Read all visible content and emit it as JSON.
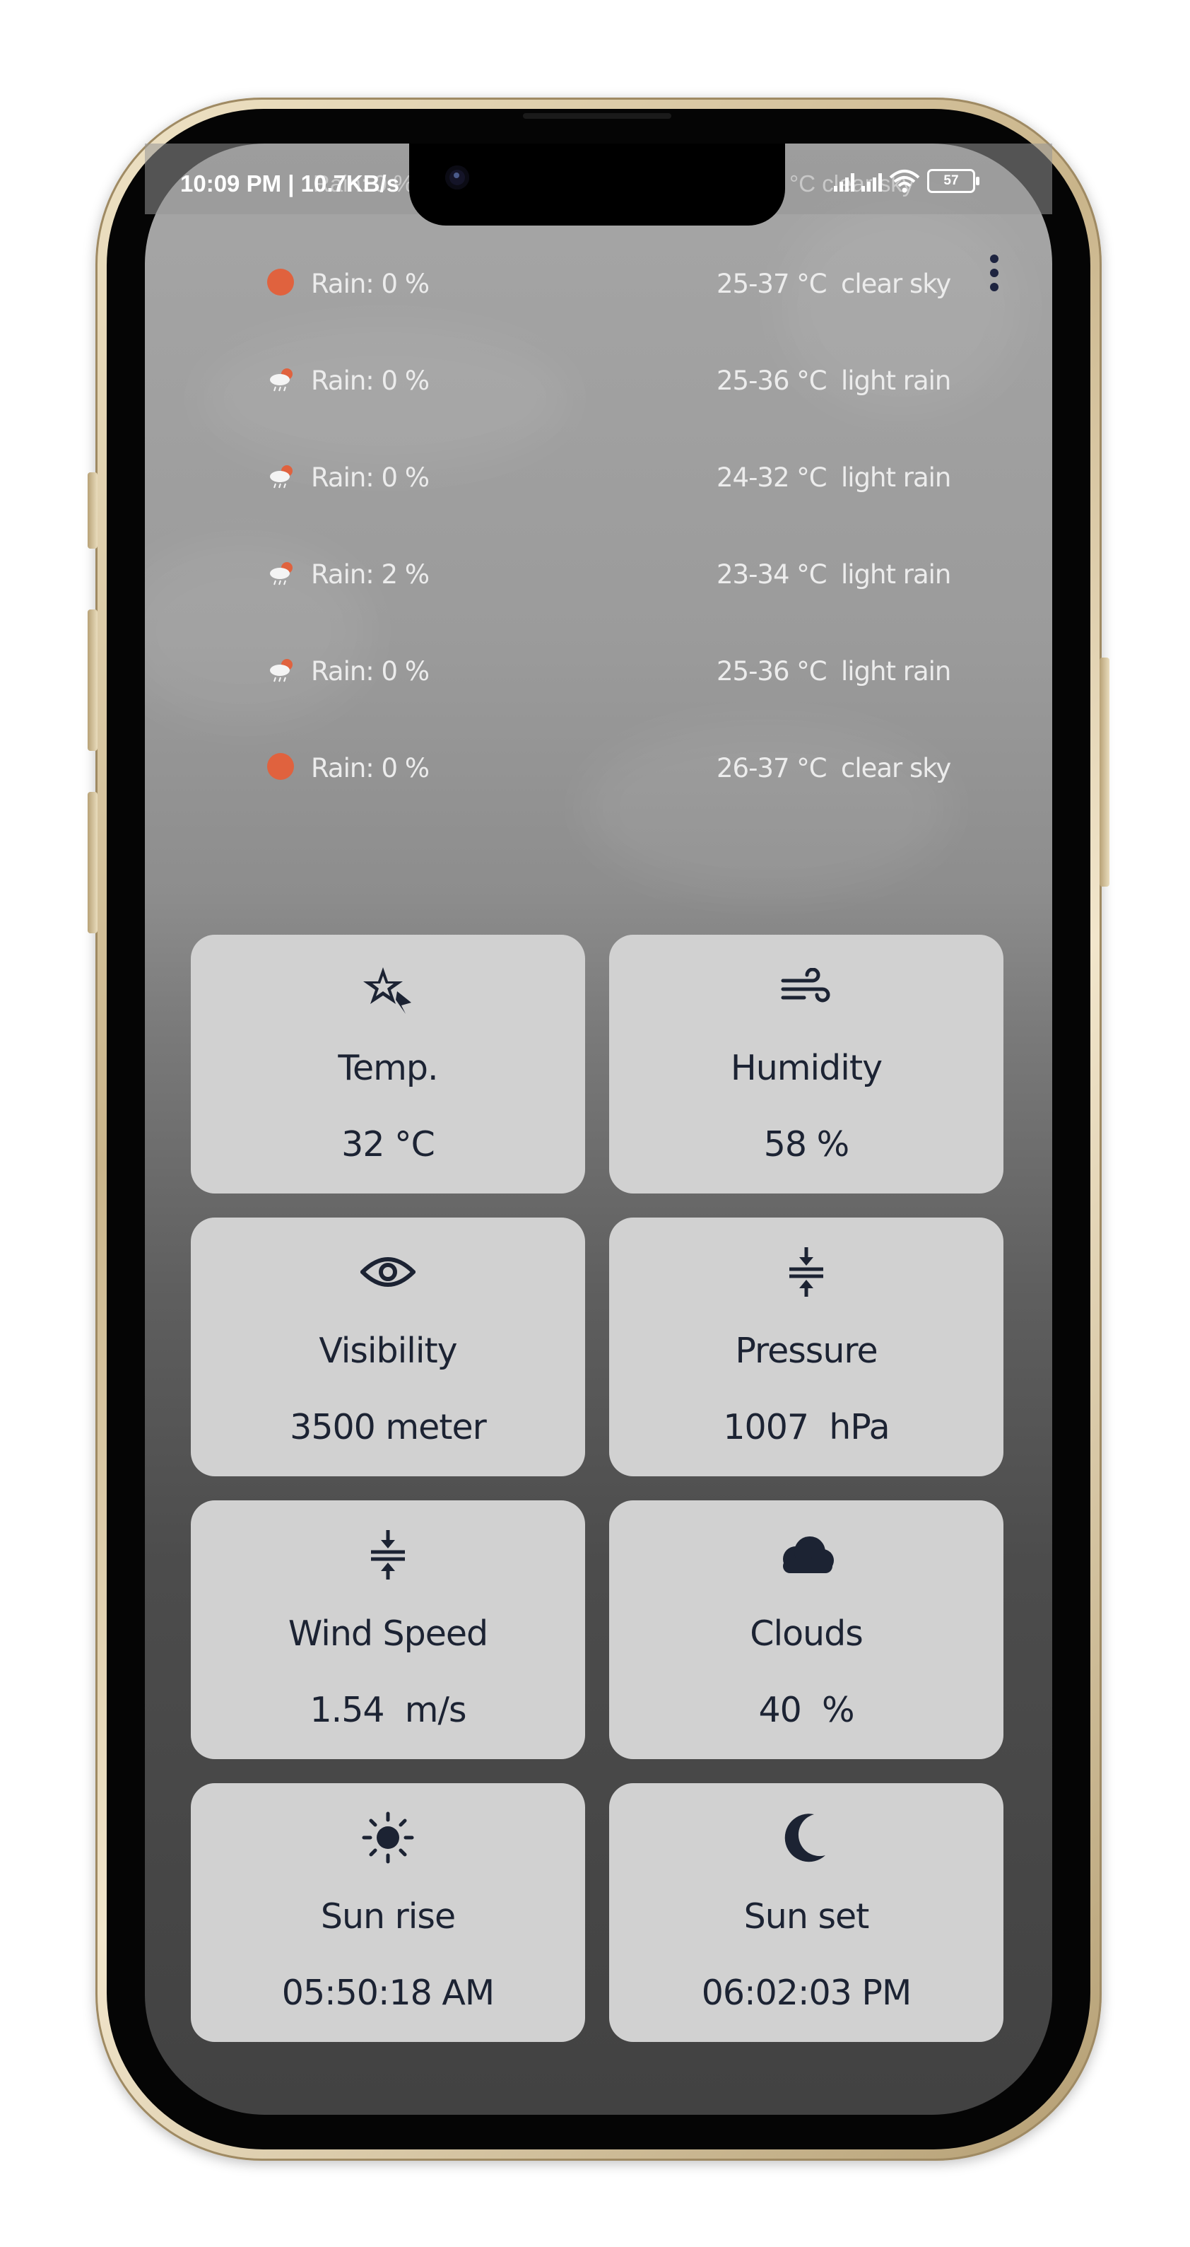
{
  "status_bar": {
    "time": "10:09 PM | 10.7KB/s",
    "ghost_left": "Rain: 0 %",
    "ghost_right": "°C  clear sky",
    "battery": "57",
    "icons": [
      "signal-icon",
      "signal-icon",
      "wifi-icon",
      "battery-icon"
    ]
  },
  "forecast": {
    "rows": [
      {
        "icon": "sun-dot-icon",
        "rain": "Rain: 0 %",
        "temp": "25-37 °C",
        "desc": "clear sky"
      },
      {
        "icon": "rain-cloud-icon",
        "rain": "Rain: 0 %",
        "temp": "25-36 °C",
        "desc": "light rain"
      },
      {
        "icon": "rain-cloud-icon",
        "rain": "Rain: 0 %",
        "temp": "24-32 °C",
        "desc": "light rain"
      },
      {
        "icon": "rain-cloud-icon",
        "rain": "Rain: 2 %",
        "temp": "23-34 °C",
        "desc": "light rain"
      },
      {
        "icon": "rain-cloud-icon",
        "rain": "Rain: 0 %",
        "temp": "25-36 °C",
        "desc": "light rain"
      },
      {
        "icon": "sun-dot-icon",
        "rain": "Rain: 0 %",
        "temp": "26-37 °C",
        "desc": "clear sky"
      }
    ]
  },
  "cards": [
    {
      "icon": "star-icon",
      "label": "Temp.",
      "value": "32 °C"
    },
    {
      "icon": "wind-icon",
      "label": "Humidity",
      "value": "58 %"
    },
    {
      "icon": "eye-icon",
      "label": "Visibility",
      "value": "3500 meter"
    },
    {
      "icon": "compress-icon",
      "label": "Pressure",
      "value": "1007  hPa"
    },
    {
      "icon": "compress-icon",
      "label": "Wind Speed",
      "value": "1.54  m/s"
    },
    {
      "icon": "cloud-icon",
      "label": "Clouds",
      "value": "40  %"
    },
    {
      "icon": "sun-icon",
      "label": "Sun rise",
      "value": "05:50:18 AM"
    },
    {
      "icon": "moon-icon",
      "label": "Sun set",
      "value": "06:02:03 PM"
    }
  ],
  "colors": {
    "card_bg": "#d1d1d1",
    "card_text": "#1c2333",
    "sun_dot": "#e0623e",
    "forecast_text": "#ececec"
  }
}
